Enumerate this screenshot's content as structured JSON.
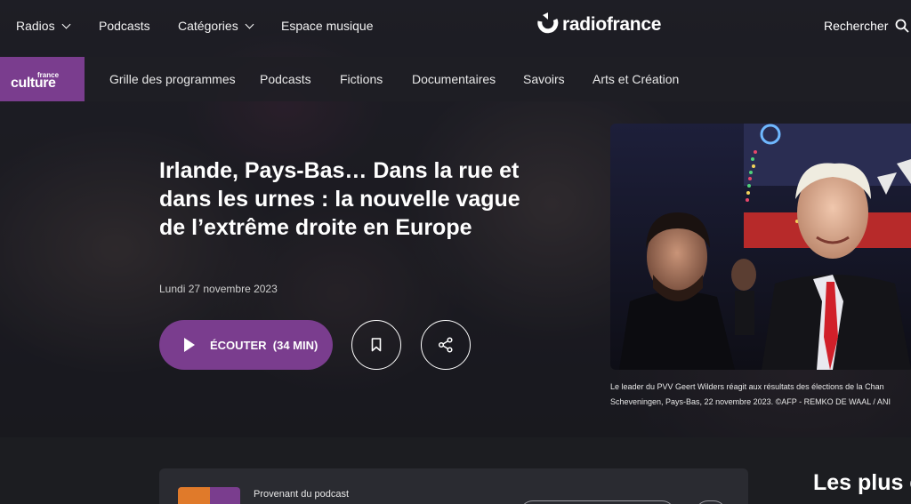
{
  "topnav": {
    "radios": "Radios",
    "podcasts": "Podcasts",
    "categories": "Catégories",
    "espace_musique": "Espace musique",
    "logo": "radiofrance",
    "search": "Rechercher"
  },
  "subnav": {
    "brand_small": "france",
    "brand_large": "culture",
    "items": [
      "Grille des programmes",
      "Podcasts",
      "Fictions",
      "Documentaires",
      "Savoirs",
      "Arts et Création"
    ]
  },
  "hero": {
    "title": "Irlande, Pays-Bas… Dans la rue et dans les urnes : la nouvelle vague de l’extrême droite en Europe",
    "date": "Lundi 27 novembre 2023",
    "listen_label": "ÉCOUTER  (34 MIN)",
    "caption_line1": "Le leader du PVV Geert Wilders réagit aux résultats des élections de la Chan",
    "caption_line2": "Scheveningen, Pays-Bas, 22 novembre 2023. ©AFP - REMKO DE WAAL / ANI"
  },
  "podcast_card": {
    "from_label": "Provenant du podcast"
  },
  "sidebar": {
    "heading": "Les plus é"
  },
  "colors": {
    "accent": "#7a3d8e",
    "background": "#1c1d21"
  }
}
